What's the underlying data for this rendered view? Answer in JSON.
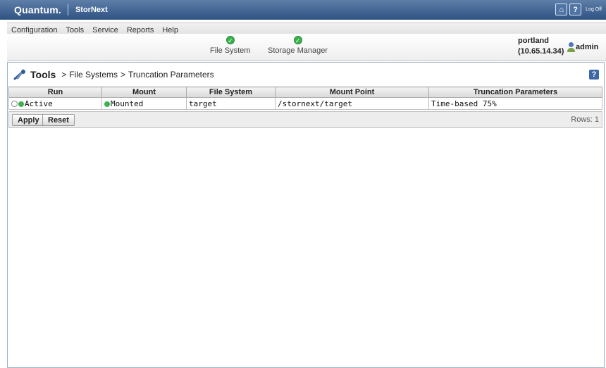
{
  "brand": {
    "logo": "Quantum.",
    "product": "StorNext",
    "logoff_label": "Log Off"
  },
  "menu": [
    "Configuration",
    "Tools",
    "Service",
    "Reports",
    "Help"
  ],
  "status": {
    "items": [
      {
        "label": "File System",
        "state": "ok"
      },
      {
        "label": "Storage Manager",
        "state": "ok"
      }
    ],
    "host_name": "portland",
    "host_ip": "(10.65.14.34)",
    "user": "admin"
  },
  "breadcrumb": {
    "root": "Tools",
    "sep": ">",
    "level1": "File Systems",
    "level2": "Truncation Parameters"
  },
  "table": {
    "columns": [
      "Run",
      "Mount",
      "File System",
      "Mount Point",
      "Truncation Parameters"
    ],
    "rows": [
      {
        "run": "Active",
        "mount": "Mounted",
        "file_system": "target",
        "mount_point": "/stornext/target",
        "truncation": "Time-based 75%"
      }
    ]
  },
  "actions": {
    "apply": "Apply",
    "reset": "Reset",
    "rows_label": "Rows: 1"
  },
  "colors": {
    "brand_bar": "#2e5283",
    "status_ok": "#39b24b",
    "panel_border": "#9db0c8"
  },
  "icons": {
    "home": "home-icon",
    "help": "help-icon",
    "tools": "wrench-icon",
    "user": "user-icon"
  }
}
